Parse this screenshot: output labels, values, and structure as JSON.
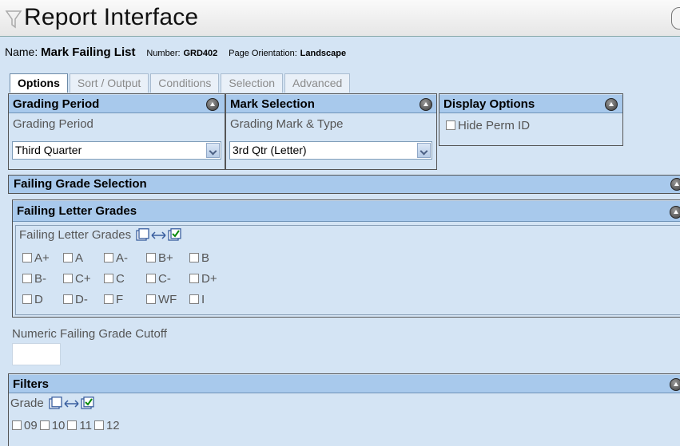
{
  "window": {
    "title": "Report Interface"
  },
  "report": {
    "name_label": "Name:",
    "name_value": "Mark Failing List",
    "number_label": "Number:",
    "number_value": "GRD402",
    "orientation_label": "Page Orientation:",
    "orientation_value": "Landscape"
  },
  "tabs": [
    {
      "label": "Options",
      "active": true
    },
    {
      "label": "Sort / Output",
      "active": false
    },
    {
      "label": "Conditions",
      "active": false
    },
    {
      "label": "Selection",
      "active": false
    },
    {
      "label": "Advanced",
      "active": false
    }
  ],
  "grading_period": {
    "header": "Grading Period",
    "field_label": "Grading Period",
    "selected": "Third Quarter"
  },
  "mark_selection": {
    "header": "Mark Selection",
    "field_label": "Grading Mark & Type",
    "selected": "3rd Qtr (Letter)"
  },
  "display_options": {
    "header": "Display Options",
    "hide_perm_id": "Hide Perm ID"
  },
  "failing_grade_selection": {
    "header": "Failing Grade Selection",
    "sub_header": "Failing Letter Grades",
    "field_label": "Failing Letter Grades",
    "grades": [
      [
        "A+",
        "A",
        "A-",
        "B+",
        "B"
      ],
      [
        "B-",
        "C+",
        "C",
        "C-",
        "D+"
      ],
      [
        "D",
        "D-",
        "F",
        "WF",
        "I"
      ]
    ],
    "cutoff_label": "Numeric Failing Grade Cutoff",
    "cutoff_value": ""
  },
  "filters": {
    "header": "Filters",
    "grade_label": "Grade",
    "grades": [
      "09",
      "10",
      "11",
      "12"
    ]
  }
}
